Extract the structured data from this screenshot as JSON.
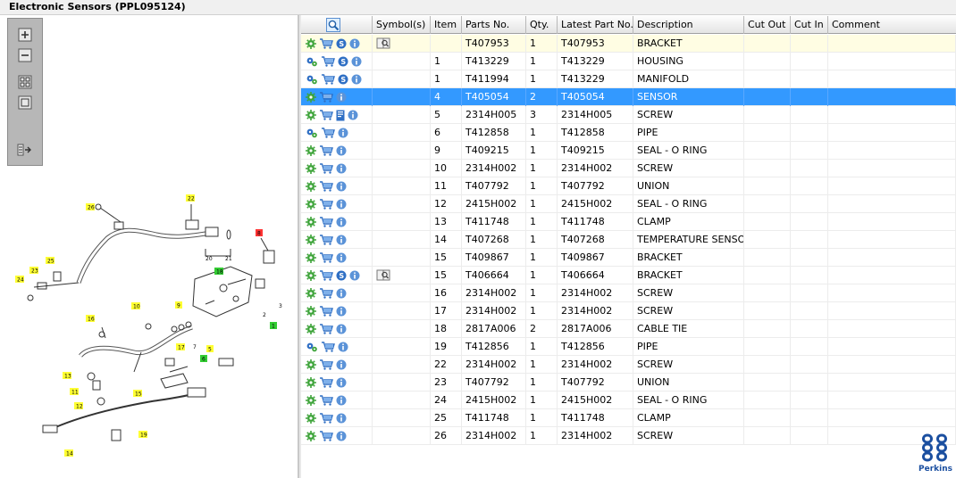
{
  "window": {
    "title": "Electronic Sensors (PPL095124)"
  },
  "toolbar": {
    "zoom_in": "zoom-in",
    "zoom_out": "zoom-out",
    "fit_all": "fit-all",
    "fit_window": "fit-window",
    "export": "export"
  },
  "grid": {
    "headers": {
      "search": "",
      "symbols": "Symbol(s)",
      "item": "Item",
      "parts_no": "Parts No.",
      "qty": "Qty.",
      "latest_part_no": "Latest Part No.",
      "description": "Description",
      "cut_out": "Cut Out",
      "cut_in": "Cut In",
      "comment": "Comment"
    },
    "rows": [
      {
        "icons": [
          "gear",
          "cart",
          "s",
          "info"
        ],
        "symbol": "book",
        "item": "",
        "parts_no": "T407953",
        "qty": "1",
        "latest": "T407953",
        "desc": "BRACKET",
        "state": "yellow"
      },
      {
        "icons": [
          "gears",
          "cart",
          "s",
          "info"
        ],
        "symbol": "",
        "item": "1",
        "parts_no": "T413229",
        "qty": "1",
        "latest": "T413229",
        "desc": "HOUSING",
        "state": ""
      },
      {
        "icons": [
          "gears",
          "cart",
          "s",
          "info"
        ],
        "symbol": "",
        "item": "1",
        "parts_no": "T411994",
        "qty": "1",
        "latest": "T413229",
        "desc": "MANIFOLD",
        "state": ""
      },
      {
        "icons": [
          "gear",
          "cart",
          "info"
        ],
        "symbol": "",
        "item": "4",
        "parts_no": "T405054",
        "qty": "2",
        "latest": "T405054",
        "desc": "SENSOR",
        "state": "selected"
      },
      {
        "icons": [
          "gear",
          "cart",
          "doc",
          "info"
        ],
        "symbol": "",
        "item": "5",
        "parts_no": "2314H005",
        "qty": "3",
        "latest": "2314H005",
        "desc": "SCREW",
        "state": ""
      },
      {
        "icons": [
          "gears",
          "cart",
          "info"
        ],
        "symbol": "",
        "item": "6",
        "parts_no": "T412858",
        "qty": "1",
        "latest": "T412858",
        "desc": "PIPE",
        "state": ""
      },
      {
        "icons": [
          "gear",
          "cart",
          "info"
        ],
        "symbol": "",
        "item": "9",
        "parts_no": "T409215",
        "qty": "1",
        "latest": "T409215",
        "desc": "SEAL - O RING",
        "state": ""
      },
      {
        "icons": [
          "gear",
          "cart",
          "info"
        ],
        "symbol": "",
        "item": "10",
        "parts_no": "2314H002",
        "qty": "1",
        "latest": "2314H002",
        "desc": "SCREW",
        "state": ""
      },
      {
        "icons": [
          "gear",
          "cart",
          "info"
        ],
        "symbol": "",
        "item": "11",
        "parts_no": "T407792",
        "qty": "1",
        "latest": "T407792",
        "desc": "UNION",
        "state": ""
      },
      {
        "icons": [
          "gear",
          "cart",
          "info"
        ],
        "symbol": "",
        "item": "12",
        "parts_no": "2415H002",
        "qty": "1",
        "latest": "2415H002",
        "desc": "SEAL - O RING",
        "state": ""
      },
      {
        "icons": [
          "gear",
          "cart",
          "info"
        ],
        "symbol": "",
        "item": "13",
        "parts_no": "T411748",
        "qty": "1",
        "latest": "T411748",
        "desc": "CLAMP",
        "state": ""
      },
      {
        "icons": [
          "gear",
          "cart",
          "info"
        ],
        "symbol": "",
        "item": "14",
        "parts_no": "T407268",
        "qty": "1",
        "latest": "T407268",
        "desc": "TEMPERATURE SENSOR",
        "state": ""
      },
      {
        "icons": [
          "gear",
          "cart",
          "info"
        ],
        "symbol": "",
        "item": "15",
        "parts_no": "T409867",
        "qty": "1",
        "latest": "T409867",
        "desc": "BRACKET",
        "state": ""
      },
      {
        "icons": [
          "gear",
          "cart",
          "s",
          "info"
        ],
        "symbol": "book",
        "item": "15",
        "parts_no": "T406664",
        "qty": "1",
        "latest": "T406664",
        "desc": "BRACKET",
        "state": ""
      },
      {
        "icons": [
          "gear",
          "cart",
          "info"
        ],
        "symbol": "",
        "item": "16",
        "parts_no": "2314H002",
        "qty": "1",
        "latest": "2314H002",
        "desc": "SCREW",
        "state": ""
      },
      {
        "icons": [
          "gear",
          "cart",
          "info"
        ],
        "symbol": "",
        "item": "17",
        "parts_no": "2314H002",
        "qty": "1",
        "latest": "2314H002",
        "desc": "SCREW",
        "state": ""
      },
      {
        "icons": [
          "gear",
          "cart",
          "info"
        ],
        "symbol": "",
        "item": "18",
        "parts_no": "2817A006",
        "qty": "2",
        "latest": "2817A006",
        "desc": "CABLE TIE",
        "state": ""
      },
      {
        "icons": [
          "gears",
          "cart",
          "info"
        ],
        "symbol": "",
        "item": "19",
        "parts_no": "T412856",
        "qty": "1",
        "latest": "T412856",
        "desc": "PIPE",
        "state": ""
      },
      {
        "icons": [
          "gear",
          "cart",
          "info"
        ],
        "symbol": "",
        "item": "22",
        "parts_no": "2314H002",
        "qty": "1",
        "latest": "2314H002",
        "desc": "SCREW",
        "state": ""
      },
      {
        "icons": [
          "gear",
          "cart",
          "info"
        ],
        "symbol": "",
        "item": "23",
        "parts_no": "T407792",
        "qty": "1",
        "latest": "T407792",
        "desc": "UNION",
        "state": ""
      },
      {
        "icons": [
          "gear",
          "cart",
          "info"
        ],
        "symbol": "",
        "item": "24",
        "parts_no": "2415H002",
        "qty": "1",
        "latest": "2415H002",
        "desc": "SEAL - O RING",
        "state": ""
      },
      {
        "icons": [
          "gear",
          "cart",
          "info"
        ],
        "symbol": "",
        "item": "25",
        "parts_no": "T411748",
        "qty": "1",
        "latest": "T411748",
        "desc": "CLAMP",
        "state": ""
      },
      {
        "icons": [
          "gear",
          "cart",
          "info"
        ],
        "symbol": "",
        "item": "26",
        "parts_no": "2314H002",
        "qty": "1",
        "latest": "2314H002",
        "desc": "SCREW",
        "state": ""
      }
    ]
  },
  "diagram": {
    "callouts": [
      "26",
      "22",
      "18",
      "8",
      "25",
      "23",
      "24",
      "10",
      "9",
      "16",
      "17",
      "5",
      "7",
      "6",
      "3",
      "2",
      "1",
      "13",
      "11",
      "12",
      "15",
      "19",
      "14",
      "20",
      "21"
    ]
  },
  "brand": {
    "name": "Perkins",
    "color": "#1b4fa0"
  },
  "colors": {
    "selected_row": "#3399ff",
    "highlight_row": "#fffde3",
    "callout_yellow": "#ffff33",
    "callout_green": "#33cc33",
    "callout_red": "#ff3333"
  }
}
